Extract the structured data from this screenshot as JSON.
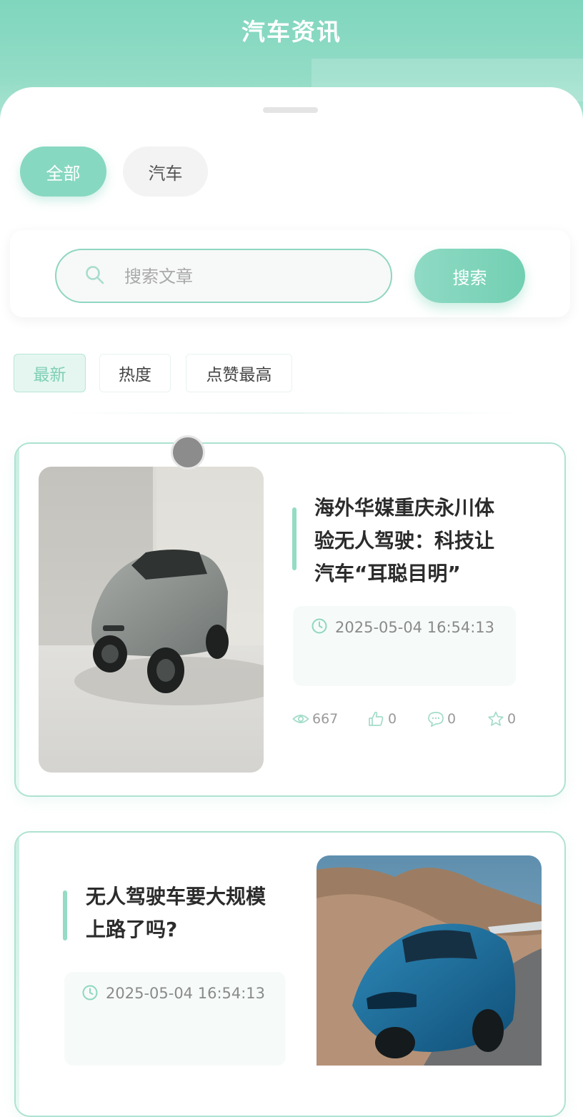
{
  "header": {
    "title": "汽车资讯"
  },
  "categories": [
    {
      "label": "全部",
      "active": true
    },
    {
      "label": "汽车",
      "active": false
    }
  ],
  "search": {
    "placeholder": "搜索文章",
    "value": "",
    "button_label": "搜索"
  },
  "sort_tabs": [
    {
      "label": "最新",
      "active": true
    },
    {
      "label": "热度",
      "active": false
    },
    {
      "label": "点赞最高",
      "active": false
    }
  ],
  "articles": [
    {
      "title": "海外华媒重庆永川体验无人驾驶：科技让汽车“耳聪目明”",
      "title_lines": [
        "海外华媒重庆永川体",
        "验无人驾驶：科技让",
        "汽车“耳聪目明”"
      ],
      "time": "2025-05-04 16:54:13",
      "views": "667",
      "likes": "0",
      "comments": "0",
      "favorites": "0",
      "image": "grey-electric-suv-in-white-studio"
    },
    {
      "title": "无人驾驶车要大规模上路了吗?",
      "title_lines": [
        "无人驾驶车要大规模",
        "上路了吗?"
      ],
      "time": "2025-05-04 16:54:13",
      "image": "blue-sports-car-on-mountain-road"
    }
  ],
  "colors": {
    "accent": "#87d8c0",
    "header_gradient_top": "#7fd6bd",
    "card_border": "#aee2d2",
    "title_text": "#2b2b2b",
    "muted_text": "#9a9a9a"
  },
  "icons": [
    "search-icon",
    "clock-icon",
    "eye-icon",
    "thumbs-up-icon",
    "comment-icon",
    "star-icon"
  ]
}
